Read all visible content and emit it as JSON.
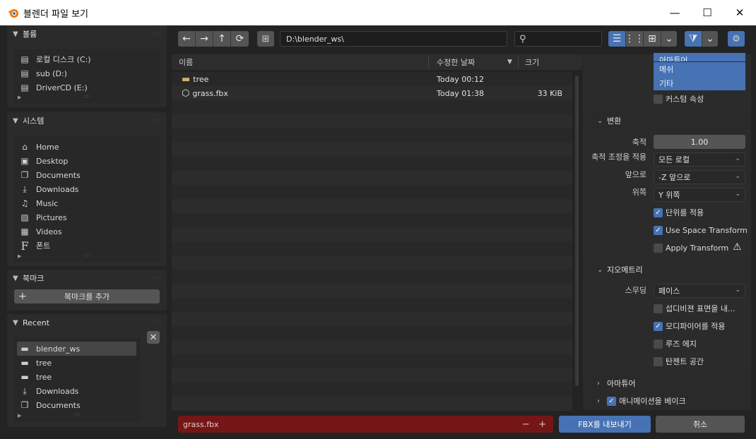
{
  "window": {
    "title": "블렌더 파일 보기",
    "minimize": "—",
    "maximize": "☐",
    "close": "✕"
  },
  "sidebar": {
    "volumes": {
      "title": "볼륨",
      "items": [
        "로컬 디스크 (C:)",
        "sub (D:)",
        "DriverCD (E:)"
      ]
    },
    "system": {
      "title": "시스템",
      "items": [
        "Home",
        "Desktop",
        "Documents",
        "Downloads",
        "Music",
        "Pictures",
        "Videos",
        "폰트"
      ]
    },
    "bookmarks": {
      "title": "북마크",
      "add_label": "북마크를 추가"
    },
    "recent": {
      "title": "Recent",
      "items": [
        "blender_ws",
        "tree",
        "tree",
        "Downloads",
        "Documents"
      ]
    }
  },
  "toolbar": {
    "path": "D:\\blender_ws\\",
    "search_placeholder": ""
  },
  "filelist": {
    "columns": {
      "name": "이름",
      "date": "수정한 날짜",
      "size": "크기"
    },
    "files": [
      {
        "name": "tree",
        "date": "Today 00:12",
        "size": "",
        "kind": "folder"
      },
      {
        "name": "grass.fbx",
        "date": "Today 01:38",
        "size": "33 KiB",
        "kind": "file"
      }
    ]
  },
  "options": {
    "object_types_partial": "아마튜어",
    "mesh_btn": "메쉬",
    "other_btn": "기타",
    "custom_props": "커스텀 속성",
    "transform": {
      "title": "변환",
      "scale_label": "축적",
      "scale_value": "1.00",
      "apply_scalings_label": "축적 조정을 적용",
      "apply_scalings_value": "모든 로컬",
      "forward_label": "앞으로",
      "forward_value": "-Z 앞으로",
      "up_label": "위쪽",
      "up_value": "Y 위쪽",
      "apply_unit": "단위를 적용",
      "use_space_transform": "Use Space Transform",
      "apply_transform": "Apply Transform"
    },
    "geometry": {
      "title": "지오메트리",
      "smoothing_label": "스무딩",
      "smoothing_value": "페이스",
      "subdiv": "섭디비젼 표면을 내...",
      "apply_modifiers": "모디파이어를 적용",
      "loose_edges": "루즈 에지",
      "tangent_space": "탄젠트 공간"
    },
    "armature": {
      "title": "아마튜어"
    },
    "bake_animation": {
      "title": "애니메이션을 베이크"
    }
  },
  "footer": {
    "filename": "grass.fbx",
    "minus": "−",
    "plus": "+",
    "export": "FBX를 내보내기",
    "cancel": "취소"
  }
}
